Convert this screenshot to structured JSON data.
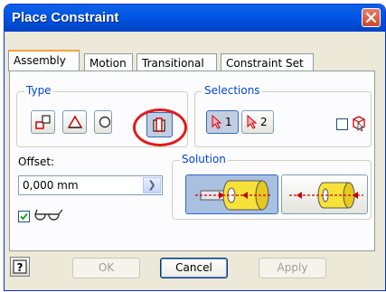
{
  "window": {
    "title": "Place Constraint",
    "close_icon": "close-icon"
  },
  "tabs": [
    {
      "label": "Assembly",
      "active": true
    },
    {
      "label": "Motion",
      "active": false
    },
    {
      "label": "Transitional",
      "active": false
    },
    {
      "label": "Constraint Set",
      "active": false
    }
  ],
  "type_group": {
    "label": "Type",
    "buttons": [
      {
        "icon": "mate-constraint-icon",
        "pressed": false
      },
      {
        "icon": "angle-constraint-icon",
        "pressed": false
      },
      {
        "icon": "tangent-constraint-icon",
        "pressed": false
      },
      {
        "icon": "insert-constraint-icon",
        "pressed": true
      }
    ]
  },
  "selections_group": {
    "label": "Selections",
    "buttons": [
      {
        "label": "1",
        "icon": "select-arrow-icon",
        "pressed": true
      },
      {
        "label": "2",
        "icon": "select-arrow-icon",
        "pressed": false
      }
    ],
    "pick_part_first_checked": false
  },
  "offset": {
    "label": "Offset:",
    "value": "0,000 mm"
  },
  "show_preview_checked": true,
  "solution_group": {
    "label": "Solution",
    "buttons": [
      {
        "icon": "opposed-solution-icon",
        "pressed": true
      },
      {
        "icon": "aligned-solution-icon",
        "pressed": false
      }
    ]
  },
  "footer": {
    "ok_label": "OK",
    "cancel_label": "Cancel",
    "apply_label": "Apply"
  },
  "colors": {
    "title_bar": "#0055e3",
    "highlight_ring": "#e21a1a",
    "group_label": "#0046d5"
  }
}
